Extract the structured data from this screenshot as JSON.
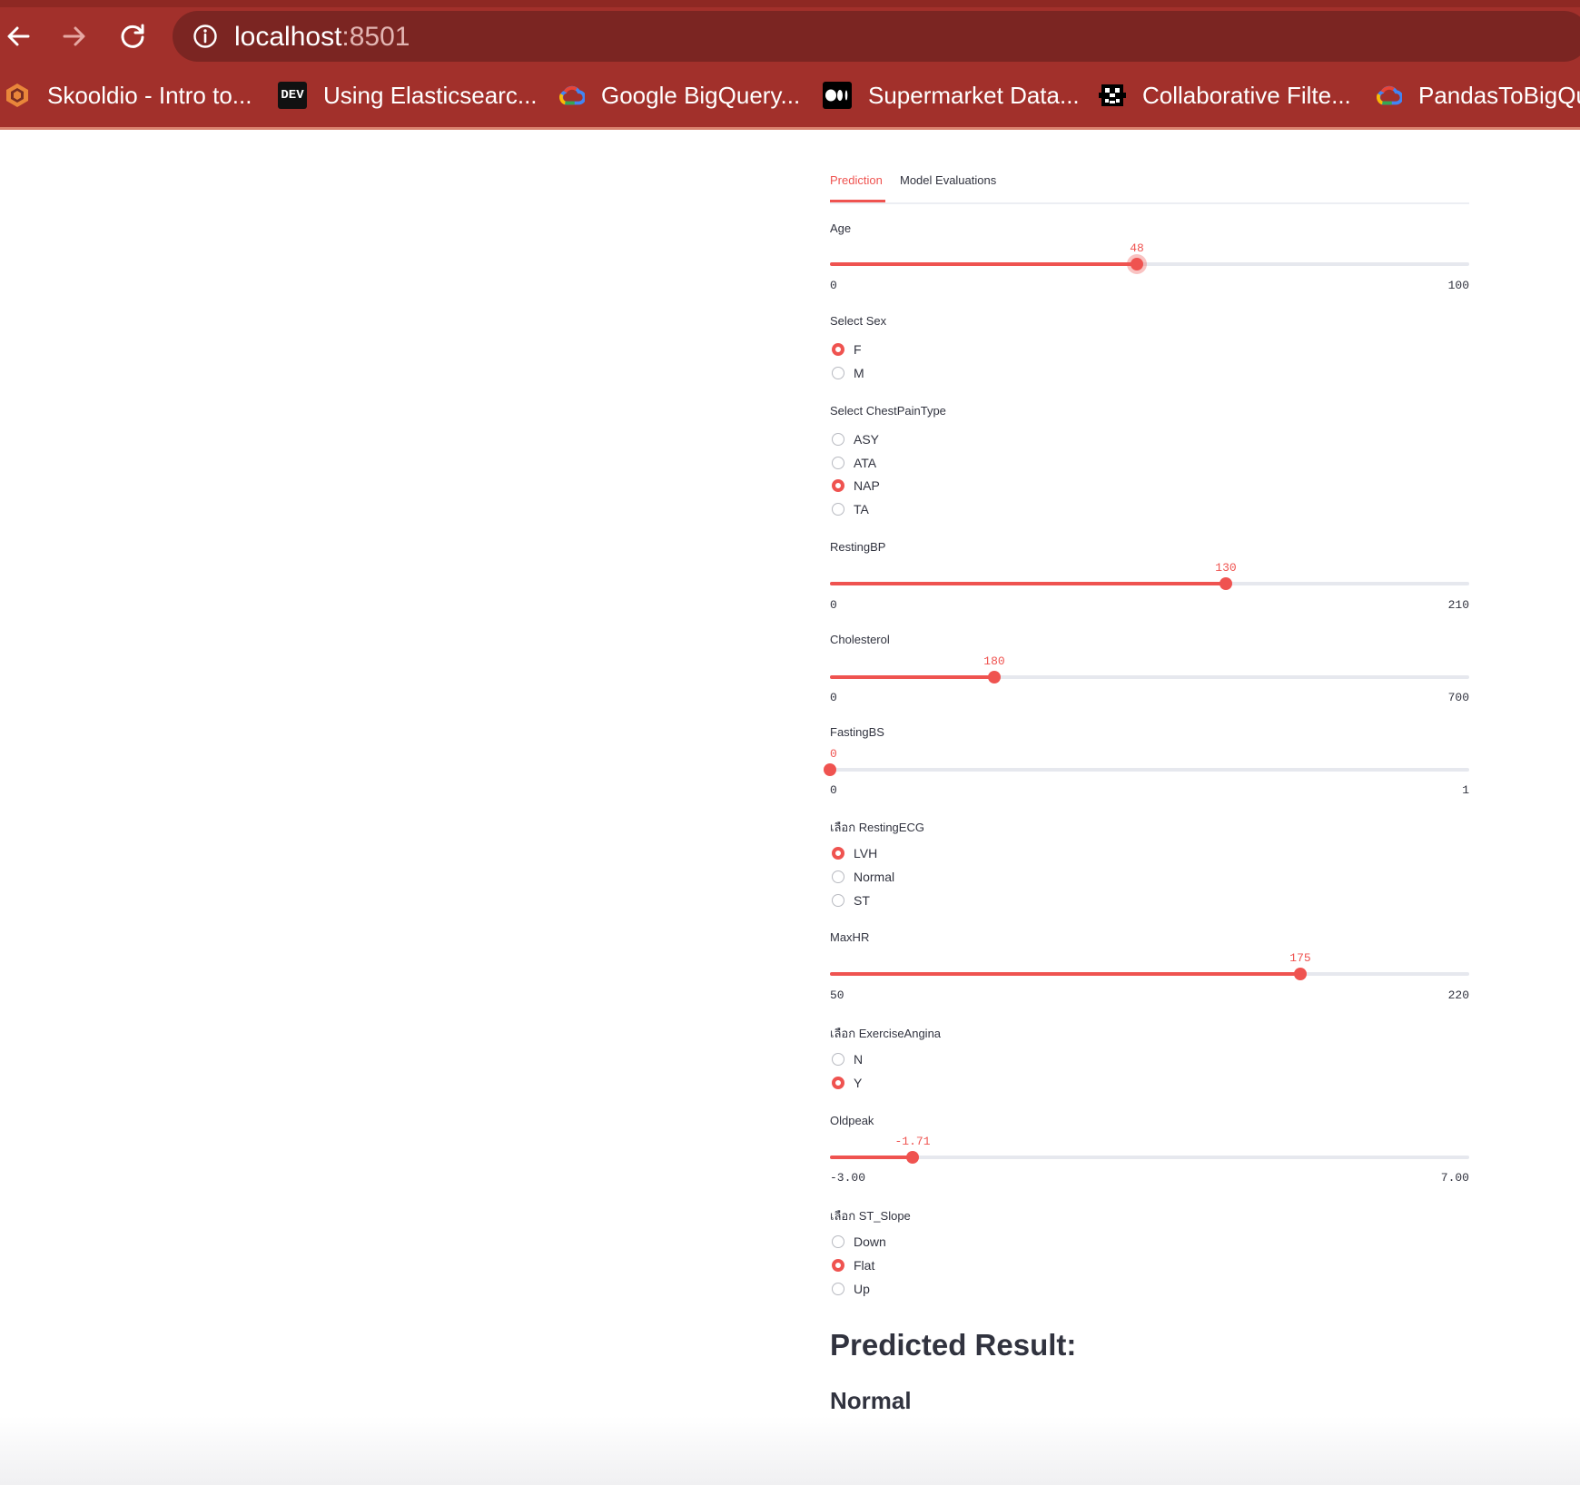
{
  "browser": {
    "url_host": "localhost",
    "url_port": ":8501",
    "bookmarks": [
      {
        "label": "Skooldio - Intro to...",
        "icon": "skooldio-icon"
      },
      {
        "label": "Using Elasticsearc...",
        "icon": "dev-icon",
        "badge": "DEV"
      },
      {
        "label": "Google BigQuery...",
        "icon": "google-cloud-icon"
      },
      {
        "label": "Supermarket Data...",
        "icon": "medium-icon"
      },
      {
        "label": "Collaborative Filte...",
        "icon": "pixel-avatar-icon"
      },
      {
        "label": "PandasToBigQue",
        "icon": "google-cloud-icon"
      }
    ]
  },
  "tabs": [
    {
      "label": "Prediction",
      "active": true
    },
    {
      "label": "Model Evaluations",
      "active": false
    }
  ],
  "form": {
    "age": {
      "label": "Age",
      "value": "48",
      "min": "0",
      "max": "100",
      "fraction": 0.48
    },
    "sex": {
      "label": "Select Sex",
      "options": [
        "F",
        "M"
      ],
      "selected": "F"
    },
    "chest": {
      "label": "Select ChestPainType",
      "options": [
        "ASY",
        "ATA",
        "NAP",
        "TA"
      ],
      "selected": "NAP"
    },
    "restingbp": {
      "label": "RestingBP",
      "value": "130",
      "min": "0",
      "max": "210",
      "fraction": 0.619
    },
    "cholesterol": {
      "label": "Cholesterol",
      "value": "180",
      "min": "0",
      "max": "700",
      "fraction": 0.257
    },
    "fastingbs": {
      "label": "FastingBS",
      "value": "0",
      "min": "0",
      "max": "1",
      "fraction": 0.0
    },
    "restingecg": {
      "label": "เลือก RestingECG",
      "options": [
        "LVH",
        "Normal",
        "ST"
      ],
      "selected": "LVH"
    },
    "maxhr": {
      "label": "MaxHR",
      "value": "175",
      "min": "50",
      "max": "220",
      "fraction": 0.735
    },
    "angina": {
      "label": "เลือก ExerciseAngina",
      "options": [
        "N",
        "Y"
      ],
      "selected": "Y"
    },
    "oldpeak": {
      "label": "Oldpeak",
      "value": "-1.71",
      "min": "-3.00",
      "max": "7.00",
      "fraction": 0.129
    },
    "slope": {
      "label": "เลือก ST_Slope",
      "options": [
        "Down",
        "Flat",
        "Up"
      ],
      "selected": "Flat"
    }
  },
  "result": {
    "heading": "Predicted Result:",
    "value": "Normal"
  },
  "colors": {
    "accent": "#ef5350",
    "browser": "#a2302b",
    "text": "#31333f"
  }
}
